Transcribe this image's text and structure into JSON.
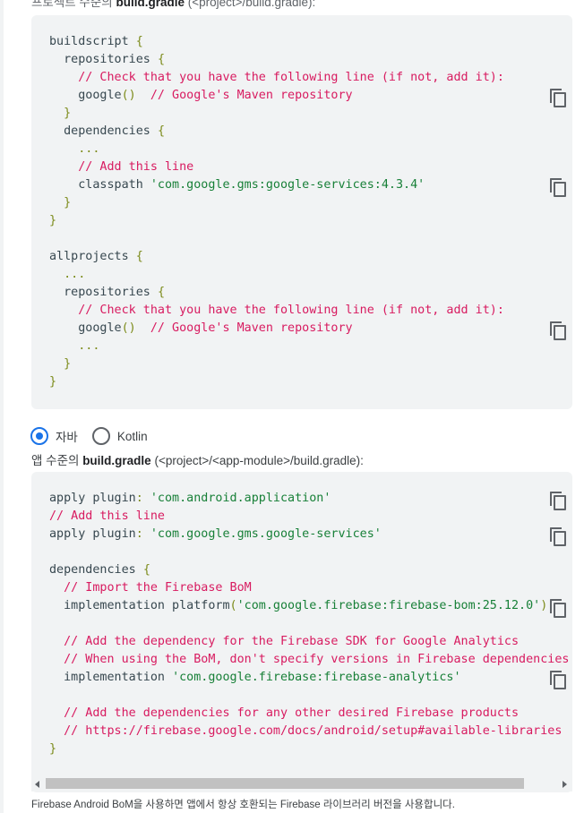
{
  "top_caption": {
    "prefix": "프로젝트 수준의 ",
    "file": "build.gradle",
    "suffix": " (<project>/build.gradle):"
  },
  "block1": {
    "lines": [
      [
        {
          "t": "buildscript "
        },
        {
          "t": "{",
          "k": "p"
        }
      ],
      [
        {
          "t": "  repositories "
        },
        {
          "t": "{",
          "k": "p"
        }
      ],
      [
        {
          "t": "    // Check that you have the following line (if not, add it):",
          "k": "c"
        }
      ],
      [
        {
          "t": "    google"
        },
        {
          "t": "()",
          "k": "p"
        },
        {
          "t": "  "
        },
        {
          "t": "// Google's Maven repository",
          "k": "c"
        }
      ],
      [
        {
          "t": "  "
        },
        {
          "t": "}",
          "k": "p"
        }
      ],
      [
        {
          "t": "  dependencies "
        },
        {
          "t": "{",
          "k": "p"
        }
      ],
      [
        {
          "t": "    ...",
          "k": "p"
        }
      ],
      [
        {
          "t": "    // Add this line",
          "k": "c"
        }
      ],
      [
        {
          "t": "    classpath "
        },
        {
          "t": "'com.google.gms:google-services:4.3.4'",
          "k": "s"
        }
      ],
      [
        {
          "t": "  "
        },
        {
          "t": "}",
          "k": "p"
        }
      ],
      [
        {
          "t": "}",
          "k": "p"
        }
      ],
      [
        {
          "t": ""
        }
      ],
      [
        {
          "t": "allprojects "
        },
        {
          "t": "{",
          "k": "p"
        }
      ],
      [
        {
          "t": "  ...",
          "k": "p"
        }
      ],
      [
        {
          "t": "  repositories "
        },
        {
          "t": "{",
          "k": "p"
        }
      ],
      [
        {
          "t": "    // Check that you have the following line (if not, add it):",
          "k": "c"
        }
      ],
      [
        {
          "t": "    google"
        },
        {
          "t": "()",
          "k": "p"
        },
        {
          "t": "  "
        },
        {
          "t": "// Google's Maven repository",
          "k": "c"
        }
      ],
      [
        {
          "t": "    ...",
          "k": "p"
        }
      ],
      [
        {
          "t": "  "
        },
        {
          "t": "}",
          "k": "p"
        }
      ],
      [
        {
          "t": "}",
          "k": "p"
        }
      ]
    ]
  },
  "language_toggle": {
    "java_label": "자바",
    "kotlin_label": "Kotlin",
    "selected": "java"
  },
  "mid_caption": {
    "prefix": "앱 수준의 ",
    "file": "build.gradle",
    "suffix": " (<project>/<app-module>/build.gradle):"
  },
  "block2": {
    "lines": [
      [
        {
          "t": "apply plugin"
        },
        {
          "t": ":",
          "k": "p"
        },
        {
          "t": " "
        },
        {
          "t": "'com.android.application'",
          "k": "s"
        }
      ],
      [
        {
          "t": "// Add this line",
          "k": "c"
        }
      ],
      [
        {
          "t": "apply plugin"
        },
        {
          "t": ":",
          "k": "p"
        },
        {
          "t": " "
        },
        {
          "t": "'com.google.gms.google-services'",
          "k": "s"
        }
      ],
      [
        {
          "t": ""
        }
      ],
      [
        {
          "t": "dependencies "
        },
        {
          "t": "{",
          "k": "p"
        }
      ],
      [
        {
          "t": "  // Import the Firebase BoM",
          "k": "c"
        }
      ],
      [
        {
          "t": "  implementation platform"
        },
        {
          "t": "(",
          "k": "p"
        },
        {
          "t": "'com.google.firebase:firebase-bom:25.12.0'",
          "k": "s"
        },
        {
          "t": ")",
          "k": "p"
        }
      ],
      [
        {
          "t": ""
        }
      ],
      [
        {
          "t": "  // Add the dependency for the Firebase SDK for Google Analytics",
          "k": "c"
        }
      ],
      [
        {
          "t": "  // When using the BoM, don't specify versions in Firebase dependencies",
          "k": "c"
        }
      ],
      [
        {
          "t": "  implementation "
        },
        {
          "t": "'com.google.firebase:firebase-analytics'",
          "k": "s"
        }
      ],
      [
        {
          "t": ""
        }
      ],
      [
        {
          "t": "  // Add the dependencies for any other desired Firebase products",
          "k": "c"
        }
      ],
      [
        {
          "t": "  // https://firebase.google.com/docs/android/setup#available-libraries",
          "k": "c"
        }
      ],
      [
        {
          "t": "}",
          "k": "p"
        }
      ]
    ]
  },
  "footnote": "Firebase Android BoM을 사용하면 앱에서 항상 호환되는 Firebase 라이브러리 버전을 사용합니다.",
  "icons": {
    "copy": "copy-icon",
    "scroll_left": "arrow-left-icon",
    "scroll_right": "arrow-right-icon"
  },
  "colors": {
    "comment": "#d81b60",
    "string": "#188038",
    "punctuation": "#7c8b1a",
    "code_bg": "#f1f3f4",
    "radio_selected": "#1a73e8"
  }
}
